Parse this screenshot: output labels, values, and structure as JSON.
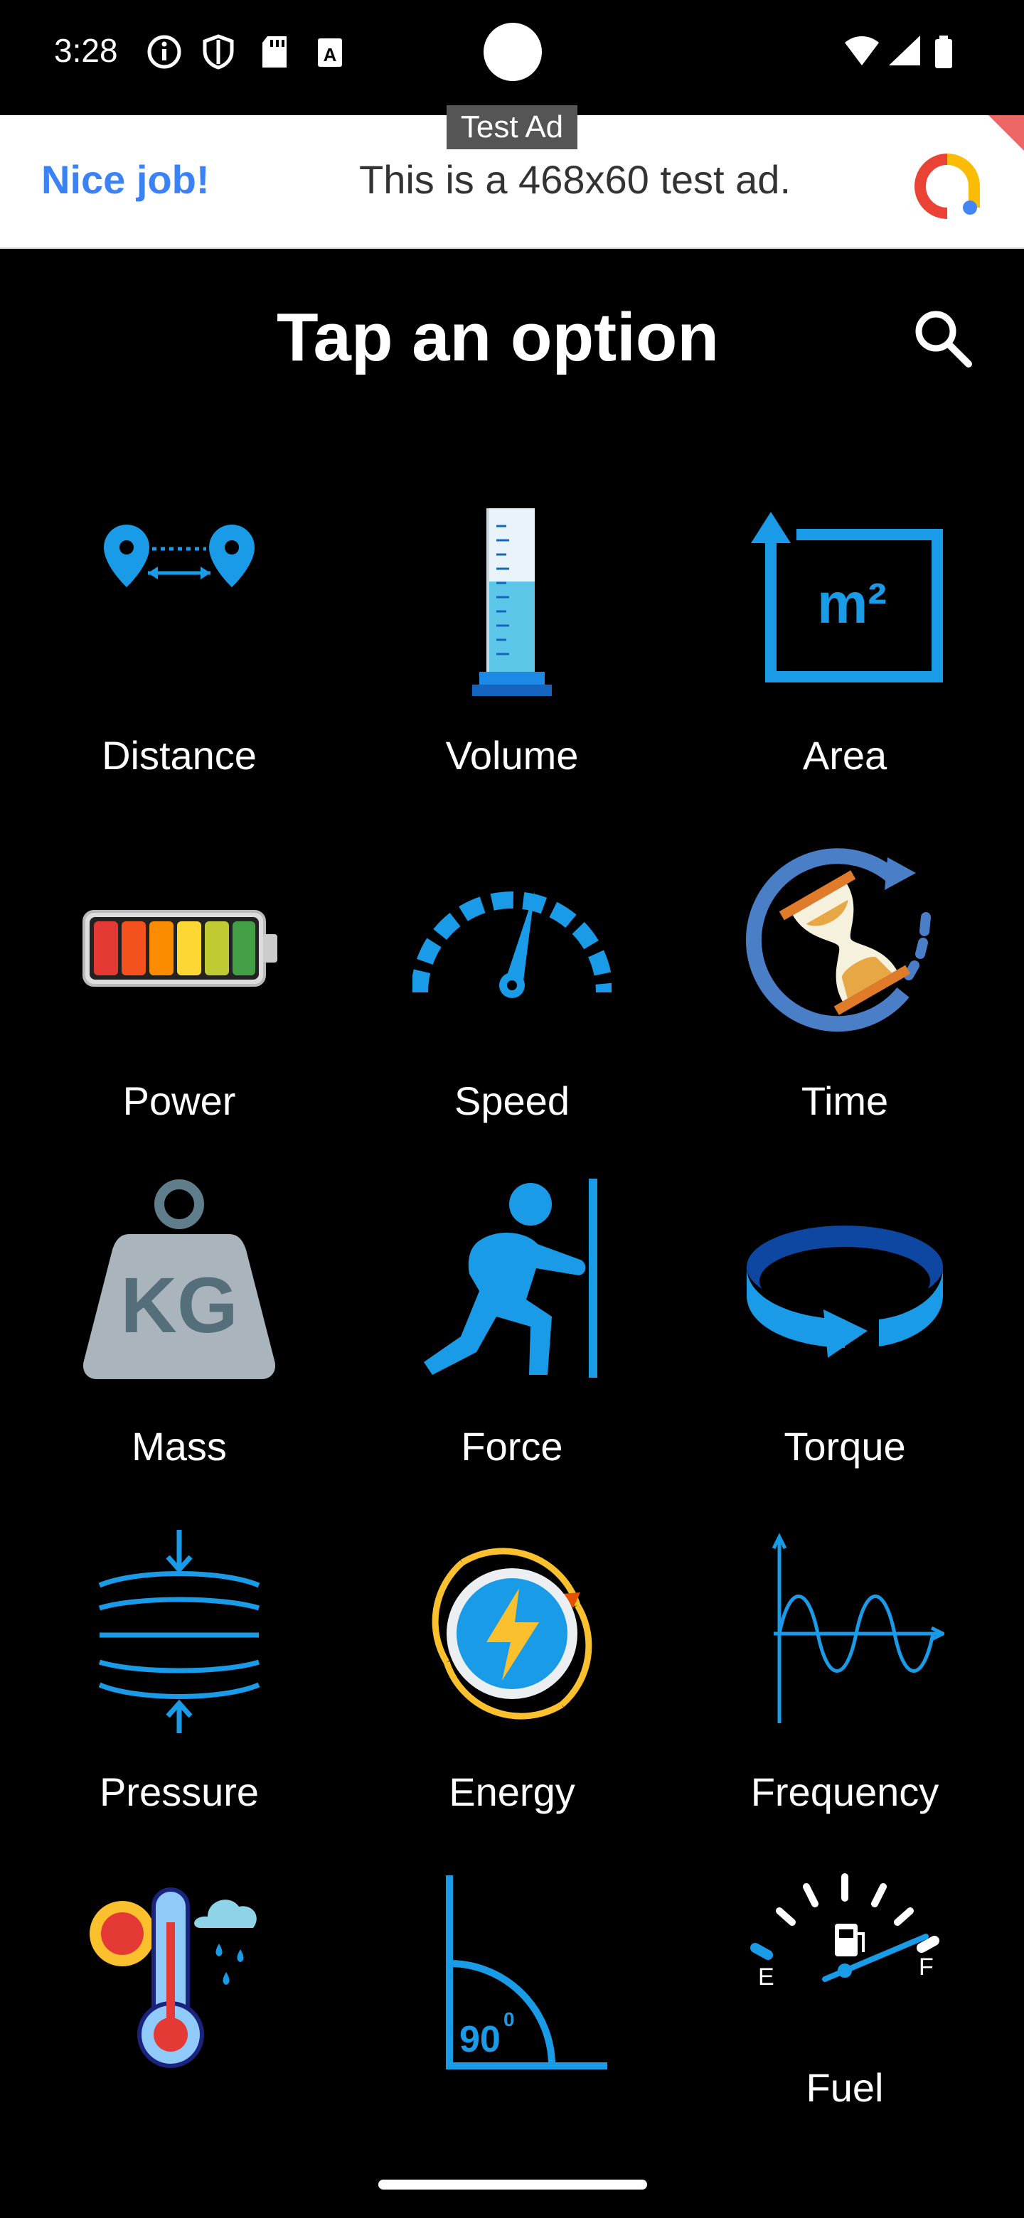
{
  "status_bar": {
    "time": "3:28"
  },
  "ad": {
    "tag": "Test Ad",
    "headline": "Nice job!",
    "body": "This is a 468x60 test ad."
  },
  "header": {
    "title": "Tap an option"
  },
  "options": [
    {
      "label": "Distance",
      "icon": "distance-icon"
    },
    {
      "label": "Volume",
      "icon": "volume-icon"
    },
    {
      "label": "Area",
      "icon": "area-icon"
    },
    {
      "label": "Power",
      "icon": "power-battery-icon"
    },
    {
      "label": "Speed",
      "icon": "speedometer-icon"
    },
    {
      "label": "Time",
      "icon": "hourglass-icon"
    },
    {
      "label": "Mass",
      "icon": "weight-kg-icon"
    },
    {
      "label": "Force",
      "icon": "pushing-person-icon"
    },
    {
      "label": "Torque",
      "icon": "rotation-icon"
    },
    {
      "label": "Pressure",
      "icon": "pressure-icon"
    },
    {
      "label": "Energy",
      "icon": "energy-icon"
    },
    {
      "label": "Frequency",
      "icon": "wave-icon"
    },
    {
      "label": "",
      "icon": "thermometer-icon"
    },
    {
      "label": "",
      "icon": "angle-icon"
    },
    {
      "label": "Fuel",
      "icon": "fuel-gauge-icon"
    }
  ],
  "icon_text": {
    "area_unit": "m²",
    "mass_unit": "KG",
    "angle_value": "90",
    "fuel_empty": "E",
    "fuel_full": "F"
  },
  "colors": {
    "accent": "#1a9be8",
    "background": "#000000",
    "ad_blue": "#3b82f6"
  }
}
